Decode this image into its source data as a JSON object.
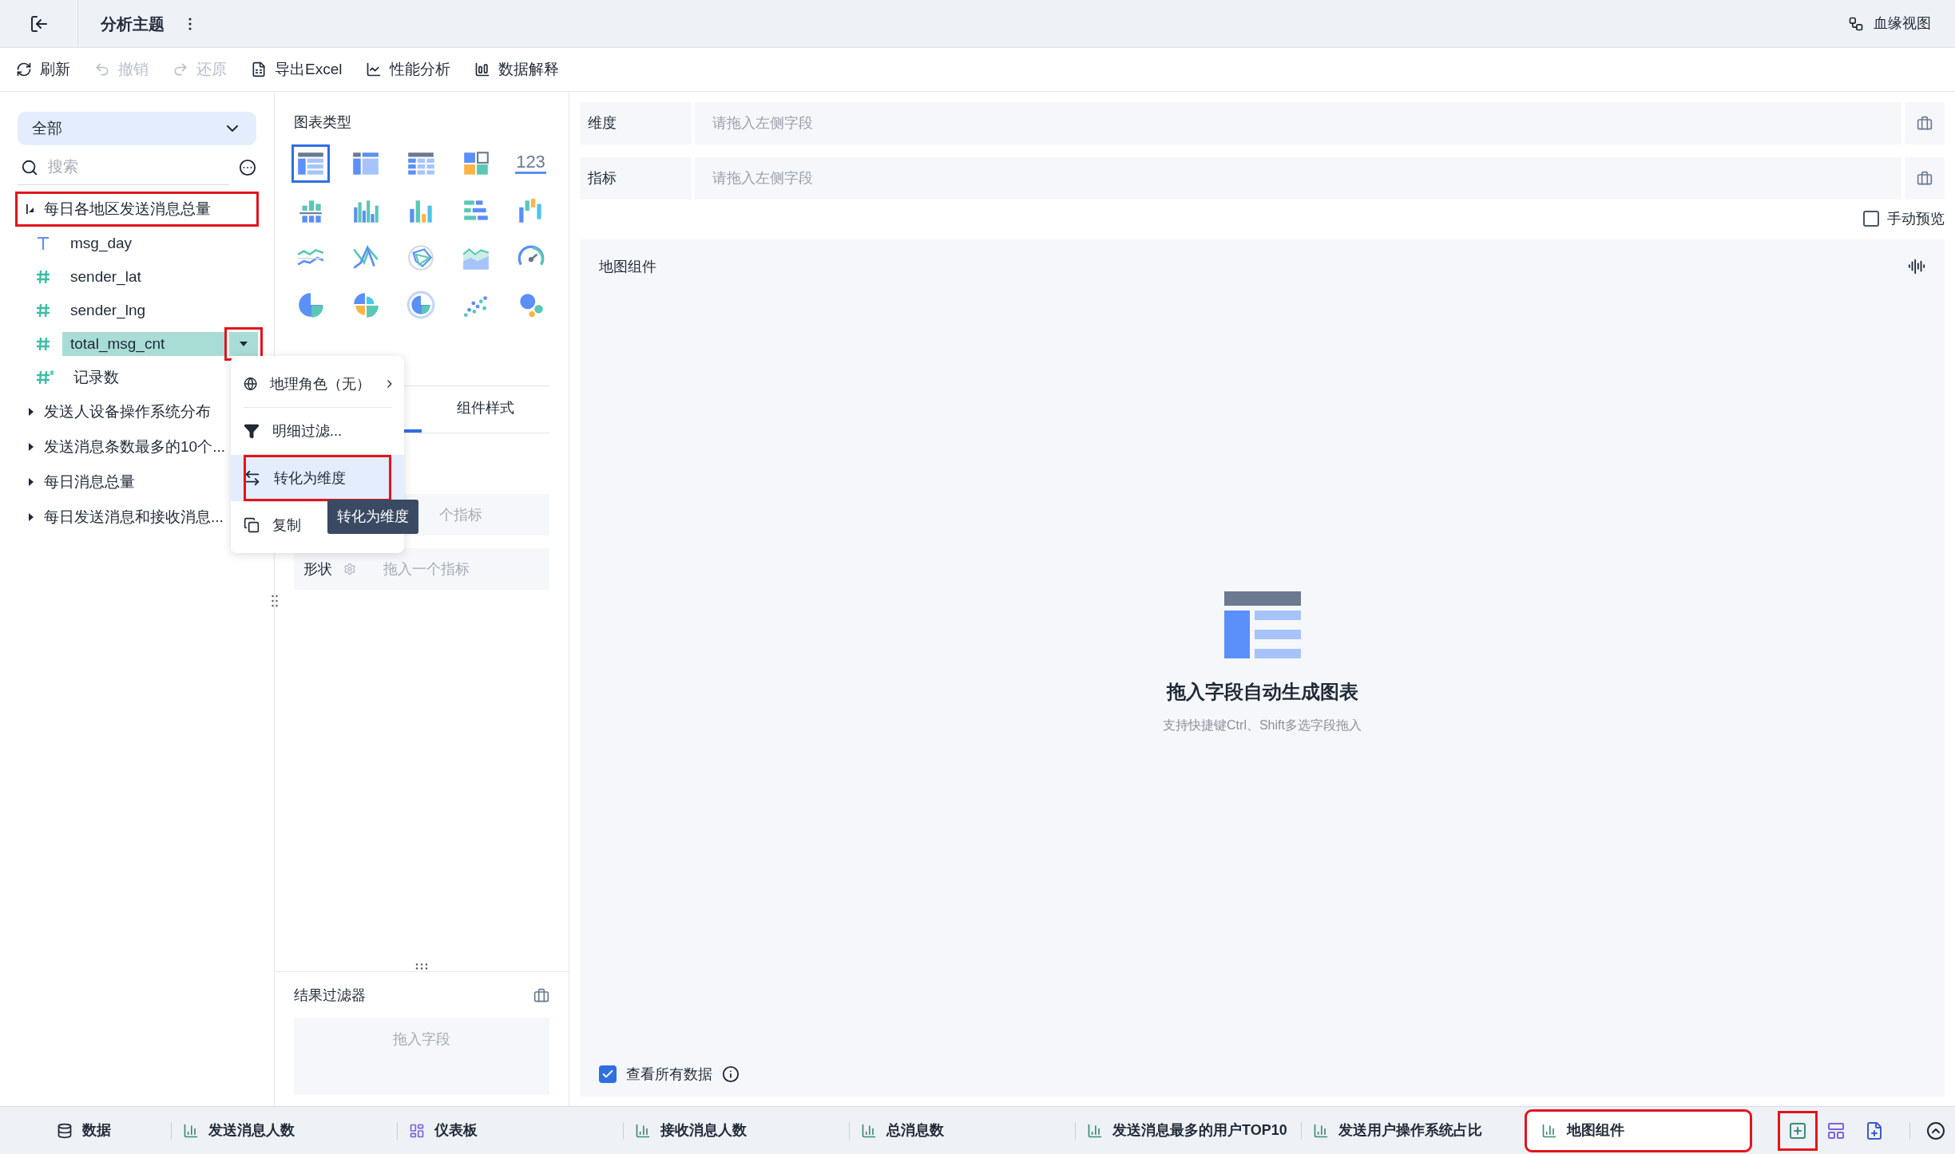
{
  "top_bar": {
    "title": "分析主题",
    "lineage_button": "血缘视图"
  },
  "toolbar": [
    {
      "kind": "refresh",
      "label": "刷新",
      "disabled": false
    },
    {
      "kind": "undo",
      "label": "撤销",
      "disabled": true
    },
    {
      "kind": "redo",
      "label": "还原",
      "disabled": true
    },
    {
      "kind": "excel",
      "label": "导出Excel",
      "disabled": false
    },
    {
      "kind": "performance",
      "label": "性能分析",
      "disabled": false
    },
    {
      "kind": "explain",
      "label": "数据解释",
      "disabled": false
    }
  ],
  "data_panel": {
    "scope": "全部",
    "search_placeholder": "搜索",
    "tree": [
      {
        "label": "每日各地区发送消息总量",
        "expanded": true,
        "annotated": true,
        "children": [
          {
            "label": "msg_day",
            "kind": "text",
            "selected": false
          },
          {
            "label": "sender_lat",
            "kind": "number",
            "selected": false
          },
          {
            "label": "sender_lng",
            "kind": "number",
            "selected": false
          },
          {
            "label": "total_msg_cnt",
            "kind": "number",
            "selected": true,
            "annotated": true
          },
          {
            "label": "记录数",
            "kind": "count",
            "selected": false
          }
        ]
      },
      {
        "label": "发送人设备操作系统分布",
        "expanded": false,
        "annotated": false
      },
      {
        "label": "发送消息条数最多的10个...",
        "expanded": false,
        "annotated": false
      },
      {
        "label": "每日消息总量",
        "expanded": false,
        "annotated": false
      },
      {
        "label": "每日发送消息和接收消息...",
        "expanded": false,
        "annotated": false
      }
    ]
  },
  "context_menu": {
    "items": [
      {
        "kind": "geo",
        "label": "地理角色（无）",
        "selected": false,
        "annotated": false
      },
      {
        "kind": "filter",
        "label": "明细过滤...",
        "selected": false,
        "annotated": false
      },
      {
        "kind": "convert",
        "label": "转化为维度",
        "selected": true,
        "annotated": true
      },
      {
        "kind": "copy",
        "label": "复制",
        "selected": false,
        "annotated": false
      }
    ],
    "tooltip": "转化为维度"
  },
  "chart_panel": {
    "title": "图表类型",
    "types": [
      {
        "kind": "table",
        "selected": true
      },
      {
        "kind": "cross_table",
        "selected": false
      },
      {
        "kind": "detail_table",
        "selected": false
      },
      {
        "kind": "indicator_card",
        "selected": false
      },
      {
        "kind": "number",
        "label": "123",
        "selected": false
      },
      {
        "kind": "stacked_bar",
        "selected": false
      },
      {
        "kind": "grouped_bar",
        "selected": false
      },
      {
        "kind": "bar",
        "selected": false
      },
      {
        "kind": "horizontal_bar",
        "selected": false
      },
      {
        "kind": "waterfall",
        "selected": false
      },
      {
        "kind": "line",
        "selected": false
      },
      {
        "kind": "multi_line",
        "selected": false
      },
      {
        "kind": "radar",
        "selected": false
      },
      {
        "kind": "area",
        "selected": false
      },
      {
        "kind": "gauge",
        "selected": false
      },
      {
        "kind": "pie",
        "selected": false
      },
      {
        "kind": "rose",
        "selected": false
      },
      {
        "kind": "ring",
        "selected": false
      },
      {
        "kind": "scatter",
        "selected": false
      },
      {
        "kind": "bubble",
        "selected": false
      }
    ],
    "tabs": [
      {
        "selected": true
      },
      {
        "label": "组件样式",
        "selected": false
      }
    ],
    "mark_rows": [
      {
        "hint": "个指标"
      },
      {
        "label": "形状",
        "hint": "拖入一个指标"
      }
    ],
    "result_filter": {
      "title": "结果过滤器",
      "placeholder": "拖入字段"
    }
  },
  "editor": {
    "shelves": [
      {
        "label": "维度",
        "placeholder": "请拖入左侧字段"
      },
      {
        "label": "指标",
        "placeholder": "请拖入左侧字段"
      }
    ],
    "manual_preview": {
      "label": "手动预览",
      "checked": false
    },
    "chart": {
      "title": "地图组件",
      "empty_title": "拖入字段自动生成图表",
      "empty_hint": "支持快捷键Ctrl、Shift多选字段拖入"
    },
    "view_all": {
      "label": "查看所有数据",
      "checked": true
    }
  },
  "bottom_tabs": [
    {
      "kind": "data",
      "label": "数据",
      "selected": false,
      "annotated": false
    },
    {
      "kind": "chart",
      "label": "发送消息人数",
      "selected": false,
      "annotated": false
    },
    {
      "kind": "dashboard",
      "label": "仪表板",
      "selected": false,
      "annotated": false
    },
    {
      "kind": "chart",
      "label": "接收消息人数",
      "selected": false,
      "annotated": false
    },
    {
      "kind": "chart",
      "label": "总消息数",
      "selected": false,
      "annotated": false
    },
    {
      "kind": "chart",
      "label": "发送消息最多的用户TOP10",
      "selected": false,
      "annotated": false
    },
    {
      "kind": "chart",
      "label": "发送用户操作系统占比",
      "selected": false,
      "annotated": false
    },
    {
      "kind": "chart",
      "label": "地图组件",
      "selected": true,
      "annotated": true
    }
  ],
  "bottom_actions": [
    {
      "kind": "add_chart",
      "annotated": true
    },
    {
      "kind": "add_dashboard"
    },
    {
      "kind": "add_report"
    }
  ]
}
